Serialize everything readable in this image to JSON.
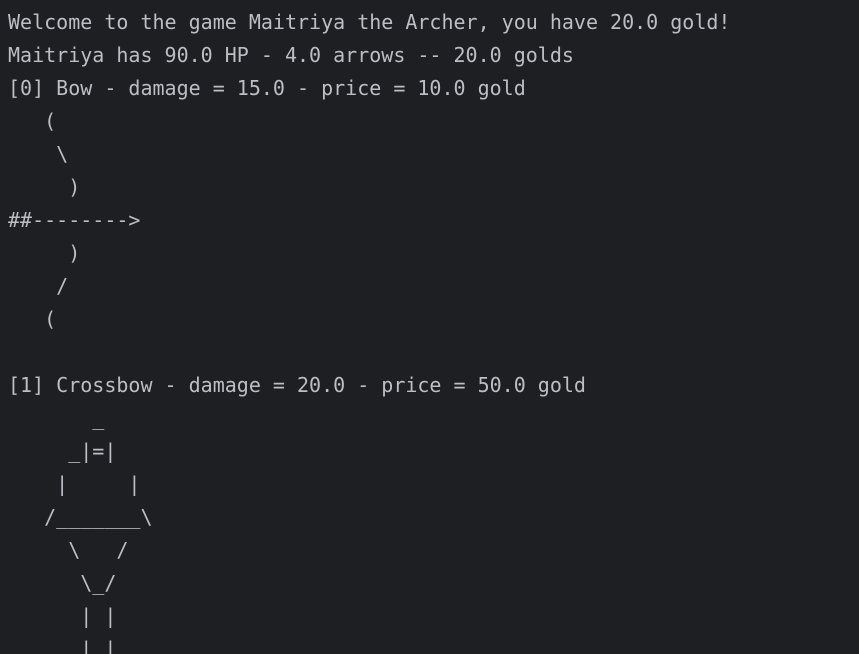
{
  "console": {
    "lines": [
      "Welcome to the game Maitriya the Archer, you have 20.0 gold!",
      "Maitriya has 90.0 HP - 4.0 arrows -- 20.0 golds",
      "[0] Bow - damage = 15.0 - price = 10.0 gold",
      "   (",
      "    \\",
      "     )",
      "##-------->",
      "     )",
      "    /",
      "   (",
      "",
      "[1] Crossbow - damage = 20.0 - price = 50.0 gold",
      "       _",
      "     _|=|",
      "    |     |",
      "   /_______\\",
      "     \\   /",
      "      \\_/",
      "      | |",
      "      | |"
    ]
  }
}
